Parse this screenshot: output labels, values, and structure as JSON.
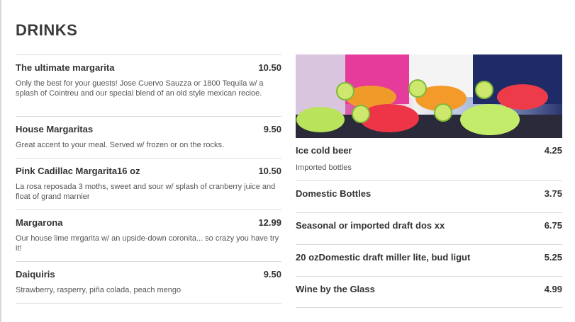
{
  "title": "DRINKS",
  "left_items": [
    {
      "name": "The ultimate margarita",
      "price": "10.50",
      "desc": "Only the best for your guests! Jose Cuervo Sauzza or 1800 Tequila w/ a splash of Cointreu and our special blend of an old style mexican recioe."
    },
    {
      "name": "House Margaritas",
      "price": "9.50",
      "desc": "Great accent to your meal. Served w/ frozen or on the rocks."
    },
    {
      "name": "Pink Cadillac Margarita16 oz",
      "price": "10.50",
      "desc": "La rosa reposada 3 moths, sweet and sour w/ splash of cranberry juice and float of grand marnier"
    },
    {
      "name": "Margarona",
      "price": "12.99",
      "desc": "Our house lime mrgarita w/ an upside-down coronita... so crazy you have try it!"
    },
    {
      "name": "Daiquiris",
      "price": "9.50",
      "desc": "Strawberry, rasperry, piña colada, peach mengo"
    }
  ],
  "right_items": [
    {
      "name": "Ice cold beer",
      "price": "4.25",
      "desc": "Imported bottles"
    },
    {
      "name": "Domestic Bottles",
      "price": "3.75",
      "desc": ""
    },
    {
      "name": "Seasonal or imported draft dos xx",
      "price": "6.75",
      "desc": ""
    },
    {
      "name": "20 ozDomestic draft miller lite, bud ligut",
      "price": "5.25",
      "desc": ""
    },
    {
      "name": "Wine by the Glass",
      "price": "4.99",
      "desc": ""
    }
  ]
}
